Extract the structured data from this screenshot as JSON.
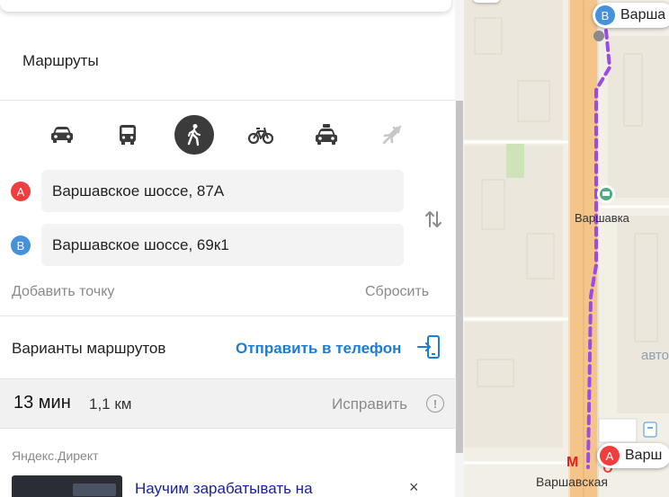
{
  "panel": {
    "title": "Маршруты",
    "modes": [
      {
        "name": "car",
        "icon": "car-icon",
        "active": false
      },
      {
        "name": "bus",
        "icon": "bus-icon",
        "active": false
      },
      {
        "name": "walk",
        "icon": "walking-person-icon",
        "active": true
      },
      {
        "name": "bike",
        "icon": "bicycle-icon",
        "active": false
      },
      {
        "name": "taxi",
        "icon": "taxi-icon",
        "active": false
      },
      {
        "name": "plane",
        "icon": "plane-icon",
        "active": false
      }
    ],
    "point_a": {
      "badge": "A",
      "value": "Варшавское шоссе, 87А"
    },
    "point_b": {
      "badge": "B",
      "value": "Варшавское шоссе, 69к1"
    },
    "add_point": "Добавить точку",
    "reset": "Сбросить",
    "variants_label": "Варианты маршрутов",
    "send_to_phone": "Отправить в телефон",
    "route": {
      "time": "13 мин",
      "distance": "1,1 км",
      "fix": "Исправить",
      "info_glyph": "!"
    },
    "ad": {
      "label": "Яндекс.Директ",
      "title": "Научим зарабатывать на",
      "close": "×"
    }
  },
  "map": {
    "labels": {
      "station_top": "Варшавка",
      "station_bottom": "Варшавская",
      "partial_auto": "авто",
      "metro_glyph": "М"
    },
    "pin_a": {
      "badge": "A",
      "text": "Варш"
    },
    "pin_b": {
      "badge": "B",
      "text": "Варша"
    }
  },
  "colors": {
    "accent": "#1a7dd9",
    "point_a": "#f03d3e",
    "point_b": "#4591db",
    "route_walk": "#9b4be8",
    "road": "#f4c489",
    "active_mode": "#3b3b3b"
  }
}
